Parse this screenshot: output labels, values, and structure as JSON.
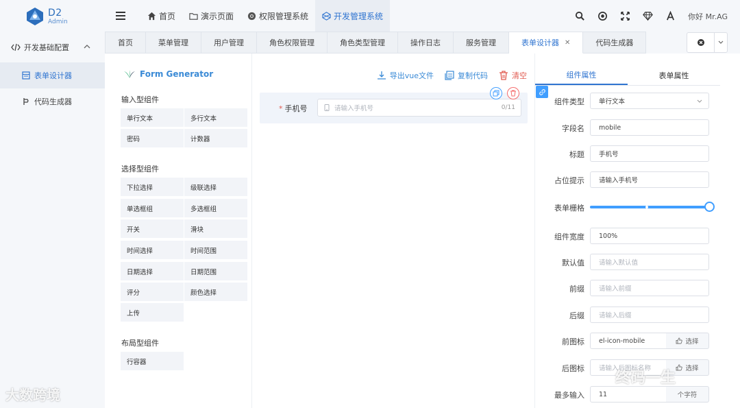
{
  "app": {
    "logo_title": "D2",
    "logo_subtitle": "Admin"
  },
  "topnav": {
    "items": [
      {
        "label": "首页",
        "icon": "home-icon"
      },
      {
        "label": "演示页面",
        "icon": "folder-icon"
      },
      {
        "label": "权限管理系统",
        "icon": "chrome-icon"
      },
      {
        "label": "开发管理系统",
        "icon": "dev-icon",
        "active": true
      }
    ],
    "greeting": "你好 Mr.AG",
    "right_icons": [
      "search-icon",
      "record-icon",
      "fullscreen-icon",
      "theme-diamond-icon",
      "font-size-icon"
    ]
  },
  "sidebar": {
    "group": "开发基础配置",
    "items": [
      {
        "label": "表单设计器",
        "active": true,
        "icon": "form-icon"
      },
      {
        "label": "代码生成器",
        "active": false,
        "icon": "code-generator-icon"
      }
    ]
  },
  "tabs": [
    {
      "label": "首页"
    },
    {
      "label": "菜单管理"
    },
    {
      "label": "用户管理"
    },
    {
      "label": "角色权限管理"
    },
    {
      "label": "角色类型管理"
    },
    {
      "label": "操作日志"
    },
    {
      "label": "服务管理"
    },
    {
      "label": "表单设计器",
      "active": true,
      "closable": true
    },
    {
      "label": "代码生成器"
    }
  ],
  "generator": {
    "title": "Form Generator",
    "actions": {
      "export": "导出vue文件",
      "copy": "复制代码",
      "clear": "清空"
    },
    "categories": [
      {
        "title": "输入型组件",
        "items": [
          "单行文本",
          "多行文本",
          "密码",
          "计数器"
        ]
      },
      {
        "title": "选择型组件",
        "items": [
          "下拉选择",
          "级联选择",
          "单选框组",
          "多选框组",
          "开关",
          "滑块",
          "时间选择",
          "时间范围",
          "日期选择",
          "日期范围",
          "评分",
          "颜色选择",
          "上传"
        ]
      },
      {
        "title": "布局型组件",
        "items": [
          "行容器"
        ]
      }
    ],
    "canvas_field": {
      "label": "手机号",
      "required": true,
      "placeholder": "请输入手机号",
      "counter": "0/11"
    }
  },
  "props": {
    "tabs": {
      "component": "组件属性",
      "form": "表单属性"
    },
    "rows": {
      "type": {
        "label": "组件类型",
        "value": "单行文本"
      },
      "field": {
        "label": "字段名",
        "value": "mobile"
      },
      "title": {
        "label": "标题",
        "value": "手机号"
      },
      "placeholder": {
        "label": "占位提示",
        "value": "请输入手机号"
      },
      "span": {
        "label": "表单栅格",
        "value": 24,
        "max": 24
      },
      "width": {
        "label": "组件宽度",
        "value": "100%"
      },
      "default": {
        "label": "默认值",
        "placeholder": "请输入默认值"
      },
      "prefix": {
        "label": "前缀",
        "placeholder": "请输入前缀"
      },
      "suffix": {
        "label": "后缀",
        "placeholder": "请输入后缀"
      },
      "prefix_icon": {
        "label": "前图标",
        "value": "el-icon-mobile",
        "button": "选择"
      },
      "suffix_icon": {
        "label": "后图标",
        "placeholder": "请输入后图标名称",
        "button": "选择"
      },
      "maxlength": {
        "label": "最多输入",
        "value": "11",
        "unit": "个字符"
      }
    }
  },
  "watermarks": {
    "left": "大数跨境",
    "right": "终码一生"
  },
  "colors": {
    "primary": "#409eff",
    "danger": "#f56c6c",
    "brand": "#2c6ebc"
  }
}
